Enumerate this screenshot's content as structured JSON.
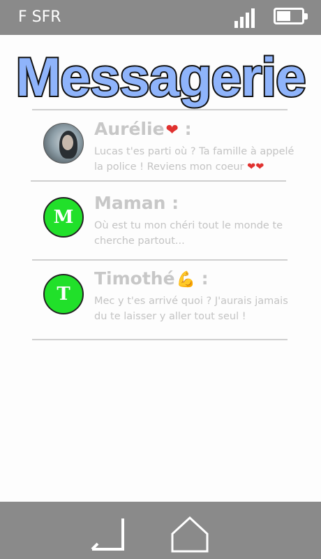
{
  "status_bar": {
    "carrier": "F SFR",
    "signal_icon": "signal-bars-icon",
    "battery_icon": "battery-icon",
    "battery_level": 0.5
  },
  "app": {
    "title": "Messagerie"
  },
  "conversations": [
    {
      "name": "Aurélie",
      "name_emoji": "❤",
      "suffix": " :",
      "avatar": "photo",
      "preview": "Lucas t'es parti où ? Ta famille à appelé la police ! Reviens mon coeur",
      "preview_emoji": "❤❤"
    },
    {
      "name": "Maman :",
      "avatar_letter": "M",
      "avatar_color": "#21e02a",
      "preview": "Où est tu mon chéri tout le monde te cherche partout..."
    },
    {
      "name": "Timothé",
      "name_emoji": "💪",
      "suffix": " :",
      "avatar_letter": "T",
      "avatar_color": "#21e02a",
      "preview": "Mec y t'es arrivé quoi ? J'aurais jamais du te laisser y aller tout seul !"
    }
  ],
  "nav": {
    "back_icon": "back-arrow-icon",
    "home_icon": "home-icon"
  },
  "colors": {
    "bars": "#8a8a8a",
    "title_fill": "#8fb4fb",
    "text_muted": "#c7c7c7"
  }
}
